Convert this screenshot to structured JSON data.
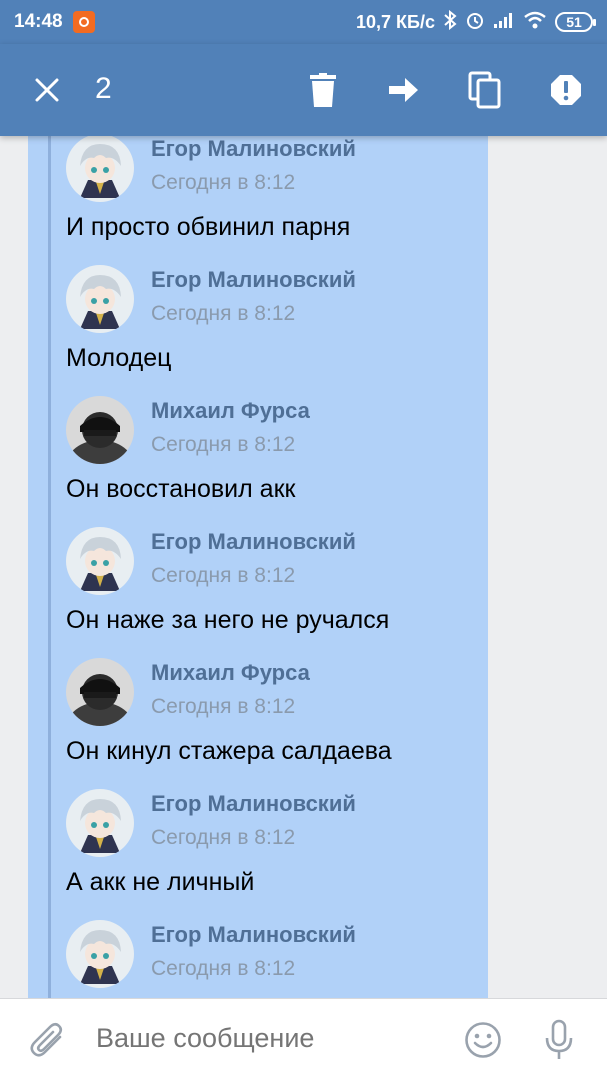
{
  "status_bar": {
    "time": "14:48",
    "network_speed": "10,7 КБ/с",
    "battery": "51",
    "icons": [
      "notification-icon",
      "bluetooth-icon",
      "alarm-icon",
      "signal-icon",
      "wifi-icon",
      "battery-icon"
    ]
  },
  "action_bar": {
    "selected_count": "2",
    "icons": [
      "close-icon",
      "delete-icon",
      "forward-icon",
      "copy-icon",
      "report-icon"
    ]
  },
  "messages": [
    {
      "author": "Егор Малиновский",
      "time": "Сегодня в 8:12",
      "text": "И просто обвинил парня",
      "avatar": "egor"
    },
    {
      "author": "Егор Малиновский",
      "time": "Сегодня в 8:12",
      "text": "Молодец",
      "avatar": "egor"
    },
    {
      "author": "Михаил Фурса",
      "time": "Сегодня в 8:12",
      "text": "Он восстановил акк",
      "avatar": "mikhail"
    },
    {
      "author": "Егор Малиновский",
      "time": "Сегодня в 8:12",
      "text": "Он наже за него не ручался",
      "avatar": "egor"
    },
    {
      "author": "Михаил Фурса",
      "time": "Сегодня в 8:12",
      "text": "Он кинул стажера салдаева",
      "avatar": "mikhail"
    },
    {
      "author": "Егор Малиновский",
      "time": "Сегодня в 8:12",
      "text": "А акк не личный",
      "avatar": "egor"
    },
    {
      "author": "Егор Малиновский",
      "time": "Сегодня в 8:12",
      "text": "",
      "avatar": "egor"
    }
  ],
  "composer": {
    "placeholder": "Ваше сообщение",
    "icons": [
      "attach-icon",
      "emoji-icon",
      "microphone-icon"
    ]
  },
  "colors": {
    "header": "#5181b8",
    "selection": "#b1d1f8",
    "author_name": "#4f6f96",
    "timestamp": "#8a9aad"
  }
}
